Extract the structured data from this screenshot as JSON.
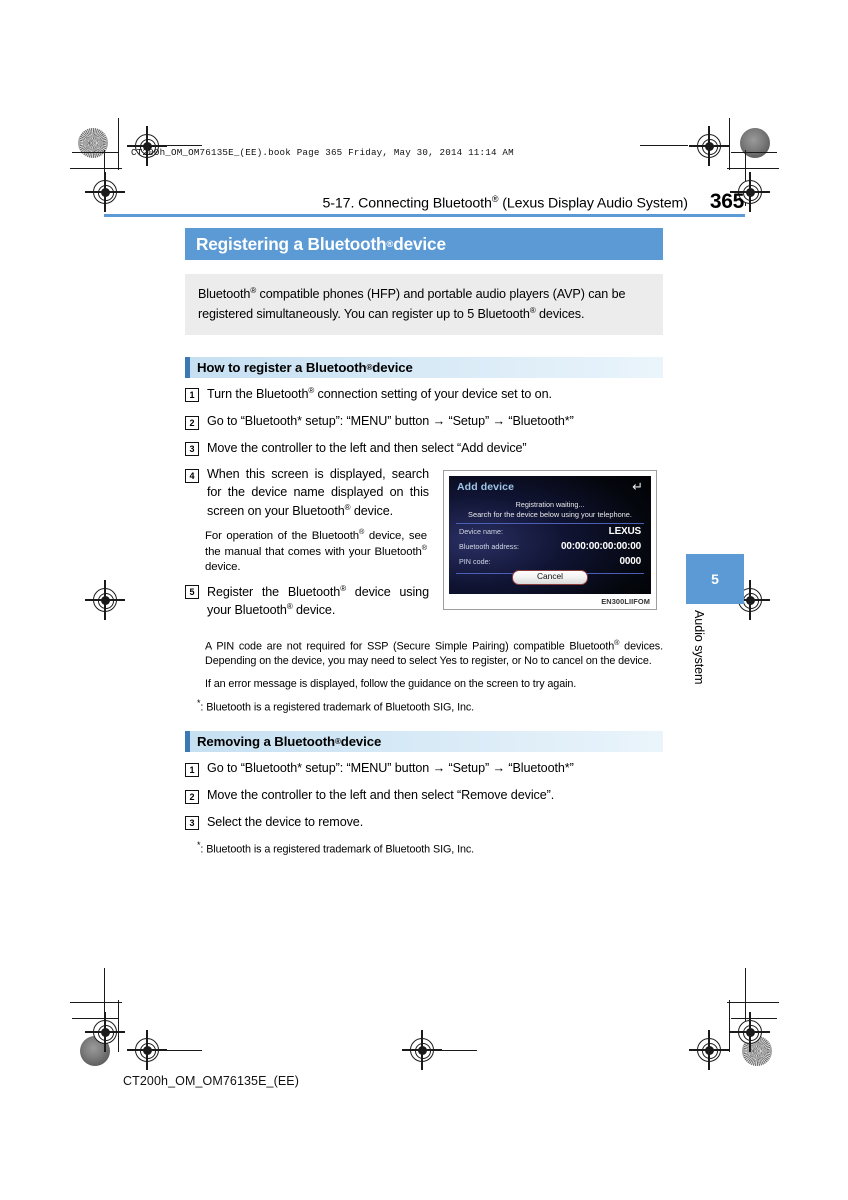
{
  "print_marks": {
    "file_stamp": "CT200h_OM_OM76135E_(EE).book  Page 365  Friday, May 30, 2014  11:14 AM",
    "footer_stamp": "CT200h_OM_OM76135E_(EE)"
  },
  "header": {
    "running_head": "5-17. Connecting Bluetooth® (Lexus Display Audio System)",
    "running_head_plain": "5-17. Connecting Bluetooth",
    "running_head_tail": " (Lexus Display Audio System)",
    "page_number": "365",
    "rule_color": "#5b9ad5"
  },
  "section": {
    "title_prefix": "Registering a Bluetooth",
    "title_suffix": " device",
    "title_bar_color": "#5b9ad5",
    "intro_line1": "Bluetooth",
    "intro_line1_rest": " compatible phones (HFP) and portable audio players (AVP) can",
    "intro_line2_a": "be registered simultaneously. You can register up to 5 Bluetooth",
    "intro_line2_b": " devices."
  },
  "register": {
    "sub_header_prefix": "How to register a Bluetooth",
    "sub_header_suffix": " device",
    "steps": [
      {
        "num": "1",
        "text_a": "Turn the Bluetooth",
        "text_b": " connection setting of your device set to on."
      },
      {
        "num": "2",
        "text_a": "Go to “Bluetooth* setup”: “MENU” button → “Setup” → “Bluetooth*”",
        "text_b": ""
      },
      {
        "num": "3",
        "text_a": "Move the controller to the left and then select “Add device”",
        "text_b": ""
      }
    ],
    "step4": {
      "num": "4",
      "text_a": "When this screen is displayed, search for the device name displayed on this screen on your Bluetooth",
      "text_b": " device.",
      "sub_a": "For operation of the Bluetooth",
      "sub_b": " device, see the manual that comes with your Bluetooth",
      "sub_c": " device."
    },
    "step5": {
      "num": "5",
      "text_a": "Register the Bluetooth",
      "text_b": " device using your Bluetooth",
      "text_c": " device."
    },
    "notes": [
      "A PIN code are not required for SSP (Secure Simple Pairing) compatible Bluetooth",
      " devices. Depending on the device, you may need to select Yes to register, or No to cancel on the device.",
      "If an error message is displayed, follow the guidance on the screen to try again."
    ],
    "footnote": ": Bluetooth is a registered trademark of Bluetooth SIG, Inc.",
    "footnote_marker": "*"
  },
  "device_screen": {
    "title": "Add device",
    "back_icon": "back-arrow-icon",
    "message_line1": "Registration waiting...",
    "message_line2": "Search for the device below using your telephone.",
    "rows": [
      {
        "label": "Device name:",
        "value": "LEXUS"
      },
      {
        "label": "Bluetooth address:",
        "value": "00:00:00:00:00:00"
      },
      {
        "label": "PIN code:",
        "value": "0000"
      }
    ],
    "cancel_label": "Cancel",
    "figure_code": "EN300LIIFOM"
  },
  "remove": {
    "sub_header_prefix": "Removing a Bluetooth",
    "sub_header_suffix": " device",
    "steps": [
      {
        "num": "1",
        "text": "Go to “Bluetooth* setup”: “MENU” button → “Setup” → “Bluetooth*”"
      },
      {
        "num": "2",
        "text": "Move the controller to the left and then select “Remove device”."
      },
      {
        "num": "3",
        "text": "Select the device to remove."
      }
    ],
    "footnote": ": Bluetooth is a registered trademark of Bluetooth SIG, Inc.",
    "footnote_marker": "*"
  },
  "chapter_tab": {
    "number": "5",
    "label": "Audio system",
    "color": "#5b9ad5"
  }
}
